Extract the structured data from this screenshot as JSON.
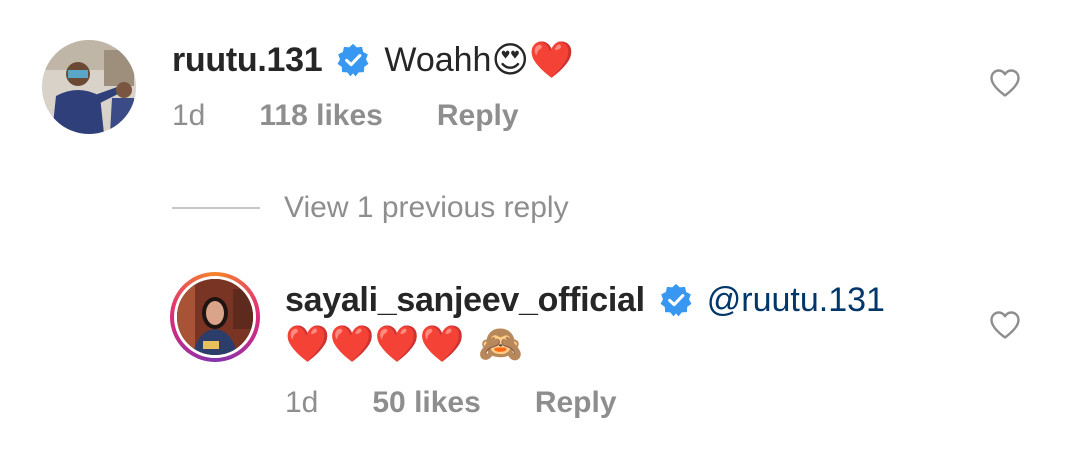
{
  "comments": [
    {
      "username": "ruutu.131",
      "text": "Woahh",
      "emojis": "😍❤️",
      "time": "1d",
      "likes": "118 likes",
      "reply_label": "Reply"
    },
    {
      "username": "sayali_sanjeev_official",
      "mention": "@ruutu.131",
      "emojis_hearts": "❤️❤️❤️❤️",
      "emoji_monkey": "🙈",
      "time": "1d",
      "likes": "50 likes",
      "reply_label": "Reply"
    }
  ],
  "view_replies": {
    "label": "View 1 previous reply"
  },
  "colors": {
    "text": "#262626",
    "secondary": "#8e8e8e",
    "verified": "#3897f0",
    "mention": "#00376b",
    "divider": "#c7c7c7"
  },
  "icons": {
    "verified": "verified-badge-icon",
    "like": "heart-outline-icon"
  }
}
